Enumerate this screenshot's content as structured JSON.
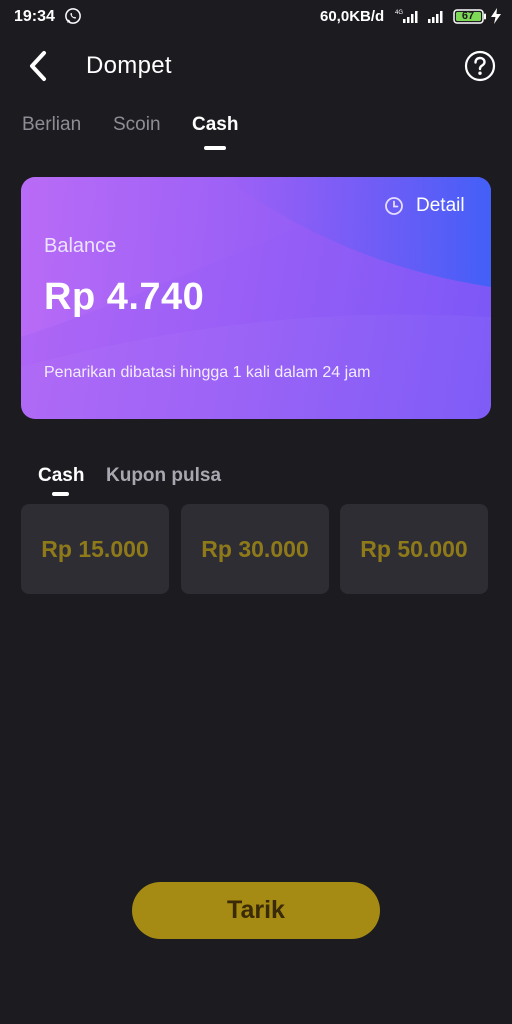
{
  "status_bar": {
    "time": "19:34",
    "net_speed": "60,0KB/d",
    "battery_level": "67",
    "icons": [
      "whatsapp-icon",
      "signal-4g-icon",
      "signal-icon",
      "battery-icon",
      "charging-icon"
    ]
  },
  "header": {
    "title": "Dompet",
    "back_icon": "chevron-left-icon",
    "help_icon": "question-circle-icon"
  },
  "top_tabs": [
    {
      "label": "Berlian",
      "active": false
    },
    {
      "label": "Scoin",
      "active": false
    },
    {
      "label": "Cash",
      "active": true
    }
  ],
  "balance_card": {
    "detail_label": "Detail",
    "detail_icon": "clock-icon",
    "balance_label": "Balance",
    "balance_amount": "Rp 4.740",
    "note": "Penarikan dibatasi hingga 1 kali dalam 24 jam"
  },
  "sub_tabs": [
    {
      "label": "Cash",
      "active": true
    },
    {
      "label": "Kupon pulsa",
      "active": false
    }
  ],
  "amount_options": [
    {
      "label": "Rp 15.000"
    },
    {
      "label": "Rp 30.000"
    },
    {
      "label": "Rp 50.000"
    }
  ],
  "withdraw_button": {
    "label": "Tarik"
  },
  "colors": {
    "background": "#1c1b20",
    "card_gradient_start": "#b167f5",
    "card_gradient_end": "#7b57f7",
    "amount_text": "#8f7a1a",
    "button": "#a58a13",
    "button_text": "#3a2a07"
  }
}
